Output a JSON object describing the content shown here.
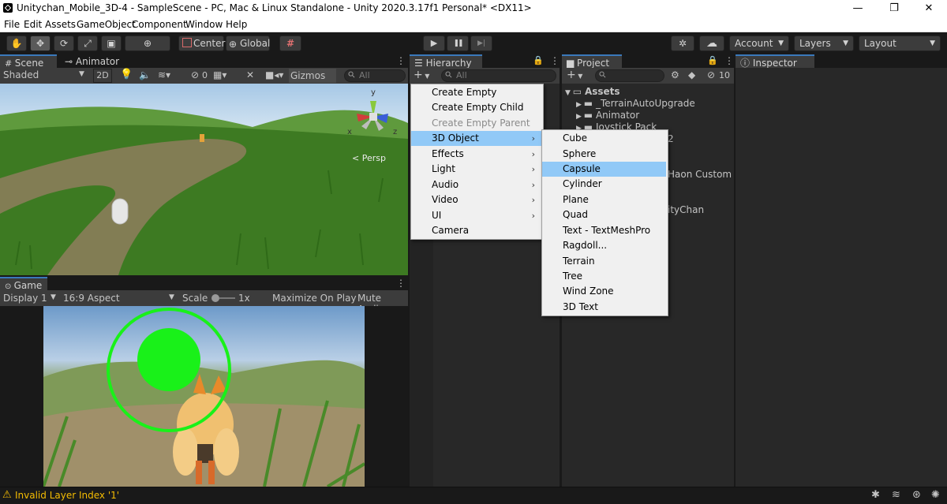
{
  "window": {
    "title": "Unitychan_Mobile_3D-4 - SampleScene - PC, Mac & Linux Standalone - Unity 2020.3.17f1 Personal* <DX11>",
    "minimize_glyph": "—",
    "maximize_glyph": "❐",
    "close_glyph": "✕"
  },
  "menubar": [
    "File",
    "Edit",
    "Assets",
    "GameObject",
    "Component",
    "Window",
    "Help"
  ],
  "toolbar": {
    "tools": [
      "hand-icon",
      "move-icon",
      "rotate-icon",
      "scale-icon",
      "rect-icon",
      "transform-icon"
    ],
    "tool_glyphs": [
      "✋",
      "✥",
      "⟳",
      "⤢",
      "▣",
      "⊕"
    ],
    "pivot_label": "Center",
    "space_label": "Global",
    "grid_glyph": "#",
    "play_glyph": "▶",
    "pause_glyph": "❚❚",
    "step_glyph": "▶|",
    "collab_glyph": "✲",
    "cloud_glyph": "☁",
    "account_label": "Account",
    "layers_label": "Layers",
    "layout_label": "Layout"
  },
  "scene_panel": {
    "tabs": [
      "Scene",
      "Animator"
    ],
    "shading_mode": "Shaded",
    "mode_2d": "2D",
    "hidden_count": "0",
    "gizmos_label": "Gizmos",
    "search_placeholder": "All",
    "gizmo_axes": {
      "y": "y",
      "x": "x",
      "z": "z"
    },
    "persp_label": "< Persp"
  },
  "game_panel": {
    "tab": "Game",
    "display": "Display 1",
    "aspect": "16:9 Aspect",
    "scale_label": "Scale",
    "scale_value": "1x",
    "maximize_on_play": "Maximize On Play",
    "mute_audio": "Mute Audio"
  },
  "hierarchy_panel": {
    "tab": "Hierarchy",
    "add_label": "+",
    "search_placeholder": "All"
  },
  "project_panel": {
    "tab": "Project",
    "add_label": "+",
    "hidden_count": "10",
    "items": [
      {
        "label": "Assets",
        "level": 0,
        "expanded": true
      },
      {
        "label": "_TerrainAutoUpgrade",
        "level": 1
      },
      {
        "label": "Animator",
        "level": 1
      },
      {
        "label": "Joystick Pack",
        "level": 1
      }
    ],
    "partial_texts": [
      "2",
      "Haon Custom",
      "ityChan"
    ]
  },
  "inspector_panel": {
    "tab": "Inspector"
  },
  "gameobject_menu": {
    "items": [
      {
        "label": "Create Empty",
        "state": "normal",
        "submenu": false
      },
      {
        "label": "Create Empty Child",
        "state": "normal",
        "submenu": false
      },
      {
        "label": "Create Empty Parent",
        "state": "disabled",
        "submenu": false
      },
      {
        "label": "3D Object",
        "state": "highlighted",
        "submenu": true
      },
      {
        "label": "Effects",
        "state": "normal",
        "submenu": true
      },
      {
        "label": "Light",
        "state": "normal",
        "submenu": true
      },
      {
        "label": "Audio",
        "state": "normal",
        "submenu": true
      },
      {
        "label": "Video",
        "state": "normal",
        "submenu": true
      },
      {
        "label": "UI",
        "state": "normal",
        "submenu": true
      },
      {
        "label": "Camera",
        "state": "normal",
        "submenu": false
      }
    ]
  },
  "object3d_submenu": {
    "items": [
      {
        "label": "Cube",
        "state": "normal"
      },
      {
        "label": "Sphere",
        "state": "normal"
      },
      {
        "label": "Capsule",
        "state": "highlighted"
      },
      {
        "label": "Cylinder",
        "state": "normal"
      },
      {
        "label": "Plane",
        "state": "normal"
      },
      {
        "label": "Quad",
        "state": "normal"
      },
      {
        "label": "Text - TextMeshPro",
        "state": "normal"
      },
      {
        "label": "Ragdoll...",
        "state": "normal"
      },
      {
        "label": "Terrain",
        "state": "normal"
      },
      {
        "label": "Tree",
        "state": "normal"
      },
      {
        "label": "Wind Zone",
        "state": "normal"
      },
      {
        "label": "3D Text",
        "state": "normal"
      }
    ]
  },
  "statusbar": {
    "warning": "Invalid Layer Index '1'",
    "warning_glyph": "⚠",
    "right_icons": [
      "bug-icon",
      "stack-icon",
      "globe-icon",
      "spider-icon"
    ],
    "right_glyphs": [
      "✱",
      "≋",
      "⊛",
      "✺"
    ]
  },
  "colors": {
    "highlight": "#91c9f7",
    "tab_accent": "#3a79bb",
    "warning": "#f4bc02",
    "joystick": "#19f119"
  }
}
